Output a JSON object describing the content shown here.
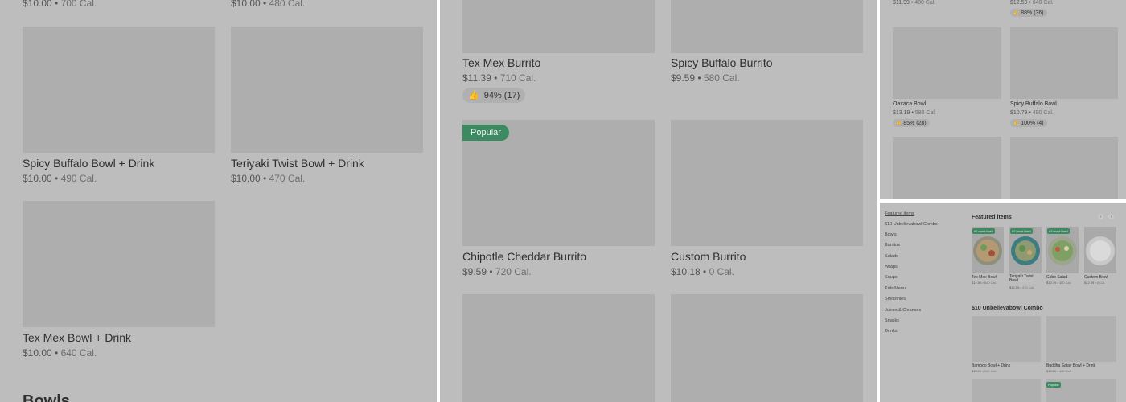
{
  "panel1": {
    "top_row": [
      {
        "price": "$10.00",
        "cal": "700 Cal."
      },
      {
        "price": "$10.00",
        "cal": "480 Cal."
      }
    ],
    "cards": [
      {
        "name": "Spicy Buffalo Bowl + Drink",
        "price": "$10.00",
        "cal": "490 Cal."
      },
      {
        "name": "Teriyaki Twist Bowl + Drink",
        "price": "$10.00",
        "cal": "470 Cal."
      },
      {
        "name": "Tex Mex Bowl + Drink",
        "price": "$10.00",
        "cal": "640 Cal."
      }
    ],
    "next_section": "Bowls"
  },
  "panel2": {
    "cards": [
      {
        "name": "Tex Mex Burrito",
        "price": "$11.39",
        "cal": "710 Cal.",
        "rating": "94% (17)"
      },
      {
        "name": "Spicy Buffalo Burrito",
        "price": "$9.59",
        "cal": "580 Cal."
      },
      {
        "name": "Chipotle Cheddar Burrito",
        "price": "$9.59",
        "cal": "720 Cal.",
        "badge": "Popular"
      },
      {
        "name": "Custom Burrito",
        "price": "$10.18",
        "cal": "0 Cal."
      }
    ]
  },
  "panel3": {
    "top_row": [
      {
        "price": "$11.99",
        "cal": "480 Cal."
      },
      {
        "price": "$12.59",
        "cal": "640 Cal.",
        "rating": "88% (36)"
      }
    ],
    "cards": [
      {
        "name": "Oaxaca Bowl",
        "price": "$13.19",
        "cal": "580 Cal.",
        "rating": "85% (28)"
      },
      {
        "name": "Spicy Buffalo Bowl",
        "price": "$10.79",
        "cal": "490 Cal.",
        "rating": "100% (4)"
      }
    ]
  },
  "panel4": {
    "nav": [
      "Featured items",
      "$10 Unbelievabowl Combo",
      "Bowls",
      "Burritos",
      "Salads",
      "Wraps",
      "Soups",
      "Kids Menu",
      "Smoothies",
      "Juices & Cleanses",
      "Snacks",
      "Drinks"
    ],
    "featured_title": "Featured items",
    "featured": [
      {
        "badge": "#1 most liked",
        "name": "Tex Mex Bowl",
        "price": "$12.59",
        "cal": "640 Cal."
      },
      {
        "badge": "#2 most liked",
        "name": "Teriyaki Twist Bowl",
        "price": "$12.59",
        "cal": "470 Cal."
      },
      {
        "badge": "#3 most liked",
        "name": "Cobb Salad",
        "price": "$10.79",
        "cal": "480 Cal."
      },
      {
        "name": "Custom Bowl",
        "price": "$12.59",
        "cal": "0 Cal."
      }
    ],
    "combo_title": "$10 Unbelievabowl Combo",
    "combo": [
      {
        "name": "Bamboo Bowl + Drink",
        "price": "$10.00",
        "cal": "540 Cal."
      },
      {
        "name": "Buddha Satay Bowl + Drink",
        "price": "$10.00",
        "cal": "480 Cal."
      }
    ],
    "popular_badge": "Popular"
  }
}
